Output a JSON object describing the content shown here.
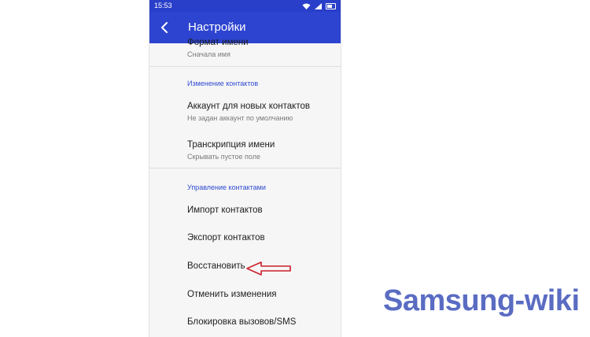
{
  "status_bar": {
    "time": "15:53"
  },
  "app_bar": {
    "title": "Настройки"
  },
  "settings": {
    "name_format": {
      "title": "Формат имени",
      "subtitle": "Сначала имя"
    },
    "section_edit": "Изменение контактов",
    "account_new": {
      "title": "Аккаунт для новых контактов",
      "subtitle": "Не задан аккаунт по умолчанию"
    },
    "transcription": {
      "title": "Транскрипция имени",
      "subtitle": "Скрывать пустое поле"
    },
    "section_manage": "Управление контактами",
    "import": "Импорт контактов",
    "export": "Экспорт контактов",
    "restore": "Восстановить",
    "undo": "Отменить изменения",
    "block": "Блокировка вызовов/SMS"
  },
  "annotation": {
    "arrow_color": "#c9202a"
  },
  "watermark": {
    "text": "Samsung-wiki"
  },
  "colors": {
    "app_bar": "#2d44d0",
    "accent": "#2f4bd1"
  }
}
